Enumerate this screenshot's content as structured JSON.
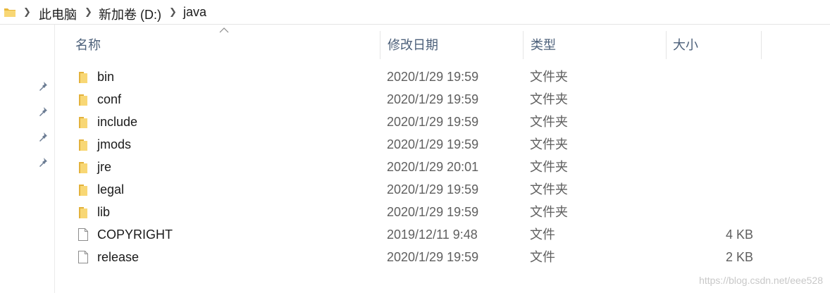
{
  "address": {
    "crumbs": [
      "此电脑",
      "新加卷 (D:)",
      "java"
    ]
  },
  "columns": {
    "name": "名称",
    "date": "修改日期",
    "type": "类型",
    "size": "大小"
  },
  "files": [
    {
      "name": "bin",
      "date": "2020/1/29 19:59",
      "type": "文件夹",
      "size": "",
      "icon": "folder-icon"
    },
    {
      "name": "conf",
      "date": "2020/1/29 19:59",
      "type": "文件夹",
      "size": "",
      "icon": "folder-icon"
    },
    {
      "name": "include",
      "date": "2020/1/29 19:59",
      "type": "文件夹",
      "size": "",
      "icon": "folder-icon"
    },
    {
      "name": "jmods",
      "date": "2020/1/29 19:59",
      "type": "文件夹",
      "size": "",
      "icon": "folder-icon"
    },
    {
      "name": "jre",
      "date": "2020/1/29 20:01",
      "type": "文件夹",
      "size": "",
      "icon": "folder-icon"
    },
    {
      "name": "legal",
      "date": "2020/1/29 19:59",
      "type": "文件夹",
      "size": "",
      "icon": "folder-icon"
    },
    {
      "name": "lib",
      "date": "2020/1/29 19:59",
      "type": "文件夹",
      "size": "",
      "icon": "folder-icon"
    },
    {
      "name": "COPYRIGHT",
      "date": "2019/12/11 9:48",
      "type": "文件",
      "size": "4 KB",
      "icon": "file-icon"
    },
    {
      "name": "release",
      "date": "2020/1/29 19:59",
      "type": "文件",
      "size": "2 KB",
      "icon": "file-icon"
    }
  ],
  "watermark": "https://blog.csdn.net/eee528",
  "colors": {
    "folder": "#f5c84c",
    "header_text": "#4c607a"
  }
}
